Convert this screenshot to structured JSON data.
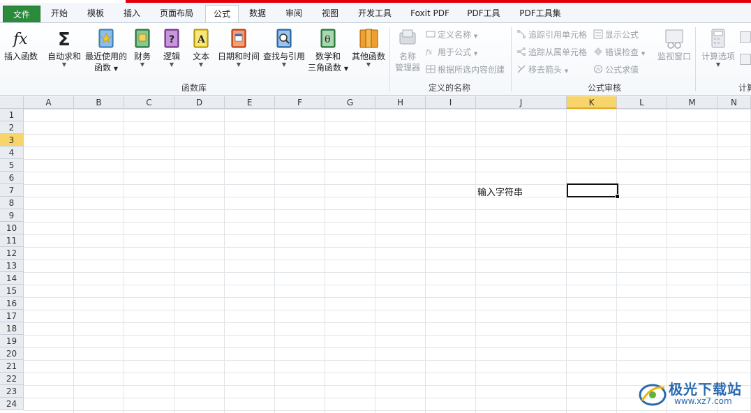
{
  "tabs": [
    {
      "label": "文件"
    },
    {
      "label": "开始"
    },
    {
      "label": "模板"
    },
    {
      "label": "插入"
    },
    {
      "label": "页面布局"
    },
    {
      "label": "公式"
    },
    {
      "label": "数据"
    },
    {
      "label": "审阅"
    },
    {
      "label": "视图"
    },
    {
      "label": "开发工具"
    },
    {
      "label": "Foxit PDF"
    },
    {
      "label": "PDF工具"
    },
    {
      "label": "PDF工具集"
    }
  ],
  "active_tab": "公式",
  "ribbon": {
    "function_library": {
      "label": "函数库",
      "insert_function": "插入函数",
      "autosum": "自动求和",
      "recent_line1": "最近使用的",
      "recent_line2": "函数",
      "finance": "财务",
      "logic": "逻辑",
      "text": "文本",
      "datetime": "日期和时间",
      "lookup": "查找与引用",
      "math_line1": "数学和",
      "math_line2": "三角函数",
      "other": "其他函数"
    },
    "defined_names": {
      "label": "定义的名称",
      "name_manager_line1": "名称",
      "name_manager_line2": "管理器",
      "define_name": "定义名称",
      "use_in_formula": "用于公式",
      "create_from_selection": "根据所选内容创建"
    },
    "formula_auditing": {
      "label": "公式审核",
      "trace_precedents": "追踪引用单元格",
      "trace_dependents": "追踪从属单元格",
      "remove_arrows": "移去箭头",
      "show_formulas": "显示公式",
      "error_checking": "错误检查",
      "evaluate_formula": "公式求值",
      "watch_window": "监视窗口"
    },
    "calculation": {
      "label": "计算",
      "calc_options": "计算选项"
    }
  },
  "sheet": {
    "columns": [
      "A",
      "B",
      "C",
      "D",
      "E",
      "F",
      "G",
      "H",
      "I",
      "J",
      "K",
      "L",
      "M",
      "N"
    ],
    "rows": [
      "1",
      "2",
      "3",
      "4",
      "5",
      "6",
      "7",
      "8",
      "9",
      "10",
      "11",
      "12",
      "13",
      "14",
      "15",
      "16",
      "17",
      "18",
      "19",
      "20",
      "21",
      "22",
      "23",
      "24"
    ],
    "selected_column": "K",
    "selected_row": "3",
    "cell_J7": "输入字符串",
    "active_cell": "K7"
  },
  "watermark": {
    "brand": "极光下载站",
    "url": "www.xz7.com"
  },
  "colors": {
    "accent_red": "#e3000b",
    "file_tab": "#2c8a3c",
    "selection": "#f7d56a"
  }
}
